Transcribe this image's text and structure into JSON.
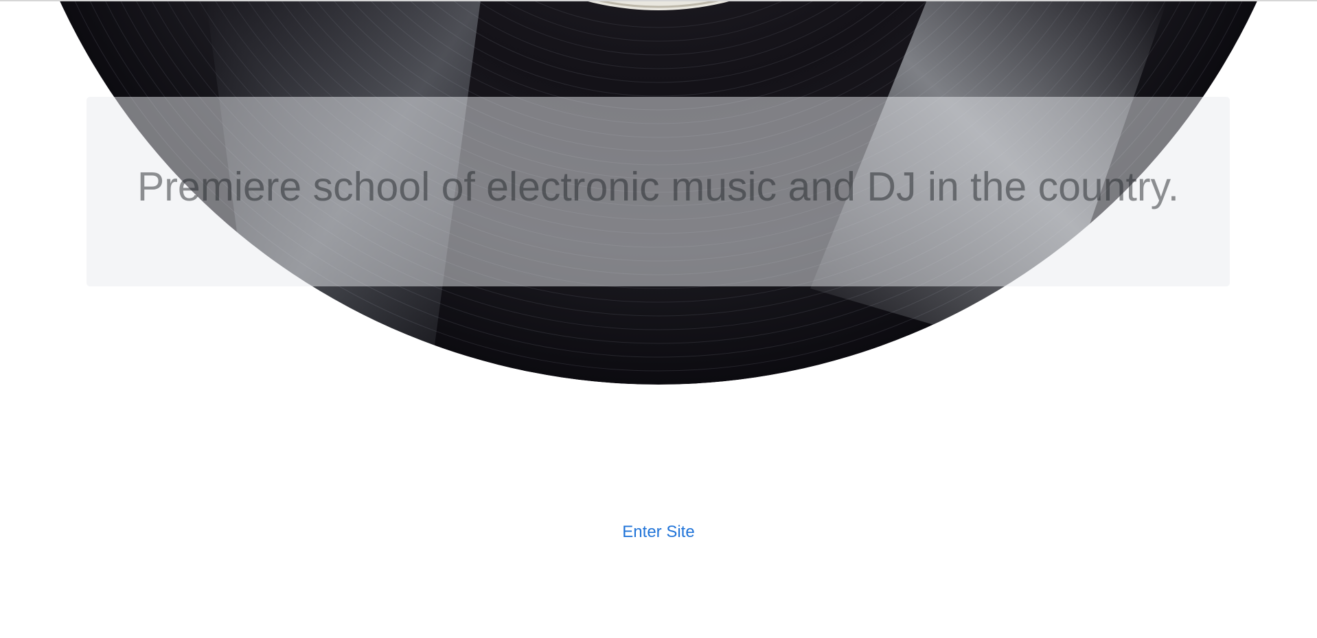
{
  "hero": {
    "headline": "Premiere school of electronic music and DJ in the country.",
    "image": "vinyl-record"
  },
  "actions": {
    "enter_label": "Enter Site"
  },
  "colors": {
    "link": "#1f73d8",
    "panel": "#e9ecef",
    "record": "#141218"
  }
}
